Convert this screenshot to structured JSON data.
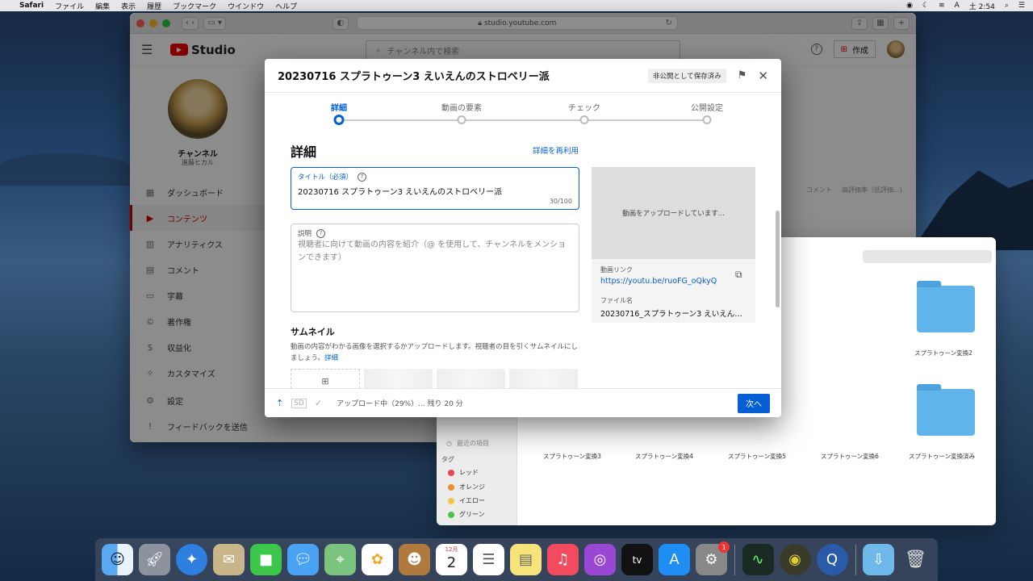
{
  "menubar": {
    "app": "Safari",
    "items": [
      "ファイル",
      "編集",
      "表示",
      "履歴",
      "ブックマーク",
      "ウインドウ",
      "ヘルプ"
    ],
    "ime": "A",
    "clock": "土 2:54"
  },
  "safari": {
    "url": "studio.youtube.com"
  },
  "studio": {
    "logo_text": "Studio",
    "search_placeholder": "チャンネル内で検索",
    "create_label": "作成",
    "channel_name": "チャンネル",
    "channel_sub": "進藤ヒカル",
    "nav": [
      {
        "label": "ダッシュボード",
        "icon": "▦"
      },
      {
        "label": "コンテンツ",
        "icon": "▶"
      },
      {
        "label": "アナリティクス",
        "icon": "▥"
      },
      {
        "label": "コメント",
        "icon": "▤"
      },
      {
        "label": "字幕",
        "icon": "▭"
      },
      {
        "label": "著作権",
        "icon": "©"
      },
      {
        "label": "収益化",
        "icon": "$"
      },
      {
        "label": "カスタマイズ",
        "icon": "✧"
      }
    ],
    "nav_bottom": [
      {
        "label": "設定",
        "icon": "⚙"
      },
      {
        "label": "フィードバックを送信",
        "icon": "!"
      }
    ],
    "col_heads": [
      "コメント",
      "高評価率（低評価...)"
    ]
  },
  "modal": {
    "title": "20230716 スプラトゥーン3 えいえんのストロベリー派",
    "saved_status": "非公開として保存済み",
    "steps": [
      "詳細",
      "動画の要素",
      "チェック",
      "公開設定"
    ],
    "section_title": "詳細",
    "reuse_link": "詳細を再利用",
    "title_field": {
      "label": "タイトル（必須）",
      "value": "20230716 スプラトゥーン3 えいえんのストロベリー派",
      "count": "30/100"
    },
    "desc_field": {
      "label": "説明",
      "placeholder": "視聴者に向けて動画の内容を紹介（@ を使用して、チャンネルをメンションできます）"
    },
    "thumbnail": {
      "title": "サムネイル",
      "desc": "動画の内容がわかる画像を選択するかアップロードします。視聴者の目を引くサムネイルにしましょう。",
      "link": "詳細"
    },
    "preview": {
      "uploading_text": "動画をアップロードしています...",
      "link_label": "動画リンク",
      "link": "https://youtu.be/ruoFG_oQkyQ",
      "file_label": "ファイル名",
      "file_name": "20230716_スプラトゥーン3 えいえんの..."
    },
    "footer": {
      "sd_badge": "SD",
      "status": "アップロード中（29%）... 残り 20 分",
      "next_label": "次へ"
    }
  },
  "finder": {
    "tags_title": "タグ",
    "partial_item": "最近の項目",
    "tags": [
      {
        "label": "レッド",
        "color": "#e5484d"
      },
      {
        "label": "オレンジ",
        "color": "#f08c2e"
      },
      {
        "label": "イエロー",
        "color": "#f5c542"
      },
      {
        "label": "グリーン",
        "color": "#4cc24c"
      }
    ],
    "folders_top": [
      "スプラトゥーン変換2"
    ],
    "folders_bottom": [
      "スプラトゥーン変換3",
      "スプラトゥーン変換4",
      "スプラトゥーン変換5",
      "スプラトゥーン変換6",
      "スプラトゥーン変換済み"
    ]
  },
  "dock": {
    "calendar_month": "12月",
    "calendar_day": "2",
    "appletv": "tv",
    "badge_count": "1"
  }
}
